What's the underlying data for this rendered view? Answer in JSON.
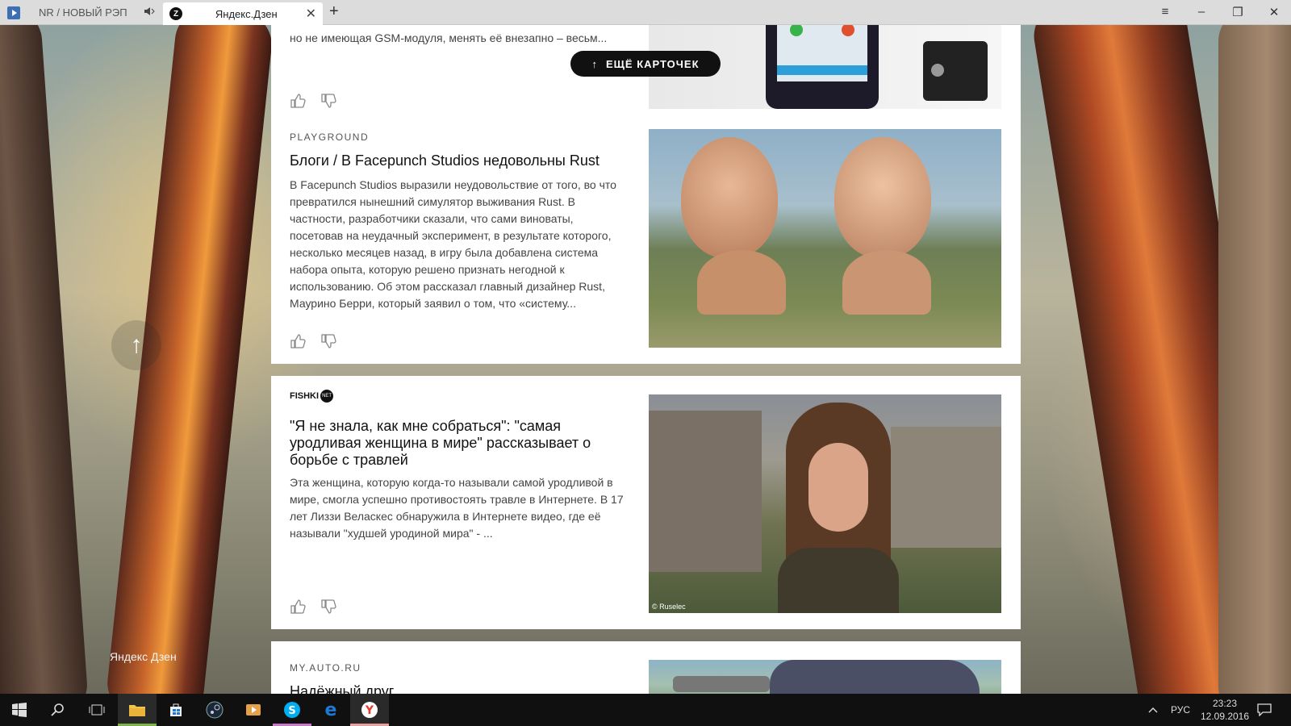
{
  "browser": {
    "tabs": [
      {
        "label": "NR / НОВЫЙ РЭП",
        "active": false,
        "icon": "play-icon",
        "sound_icon": "speaker-icon"
      },
      {
        "label": "Яндекс.Дзен",
        "active": true,
        "icon": "zen-favicon",
        "favicon_letter": "Z"
      }
    ],
    "new_tab": "+",
    "close_tab": "✕"
  },
  "feed": {
    "more_cards_button": "ЕЩЁ КАРТОЧЕК",
    "cards": [
      {
        "source": "",
        "title": "",
        "text": "но не имеющая GSM-модуля, менять её внезапно – весьм..."
      },
      {
        "source": "PLAYGROUND",
        "title": "Блоги / В Facepunch Studios недовольны Rust",
        "text": "В Facepunch Studios выразили неудовольствие от того, во что превратился нынешний симулятор выживания Rust. В частности, разработчики сказали, что сами виноваты, посетовав на неудачный эксперимент, в результате которого, несколько месяцев назад, в игру была добавлена система набора опыта, которую решено признать негодной к использованию. Об этом рассказал главный дизайнер Rust, Маурино Берри, который заявил о том, что «систему..."
      },
      {
        "source": "FISHKI",
        "source_badge": "NET",
        "title": "\"Я не знала, как мне собраться\": \"самая уродливая женщина в мире\" рассказывает о борьбе с травлей",
        "text": "Эта женщина, которую когда-то называли самой уродливой в мире, смогла успешно противостоять травле в Интернете. В 17 лет Лиззи Веласкес обнаружила в Интернете видео, где её называли \"худшей уродиной мира\" - ...",
        "image_caption": "© Ruselec"
      },
      {
        "source": "MY.AUTO.RU",
        "title": "Надёжный друг",
        "text": ""
      }
    ]
  },
  "zen_logo": "Яндекс Дзен",
  "taskbar": {
    "apps": [
      "windows-start-icon",
      "search-icon",
      "task-view-icon",
      "file-explorer-icon",
      "store-icon",
      "steam-icon",
      "media-player-icon",
      "skype-icon",
      "edge-icon",
      "yandex-browser-icon"
    ],
    "language": "РУС",
    "time": "23:23",
    "date": "12.09.2016"
  },
  "colors": {
    "accent_skype": "#00aff0",
    "accent_edge": "#1e78d6",
    "accent_yandex": "#e23b2e",
    "explorer_underline": "#7db44a",
    "skype_underline": "#c779c7",
    "yandex_underline": "#e8a0a0"
  }
}
